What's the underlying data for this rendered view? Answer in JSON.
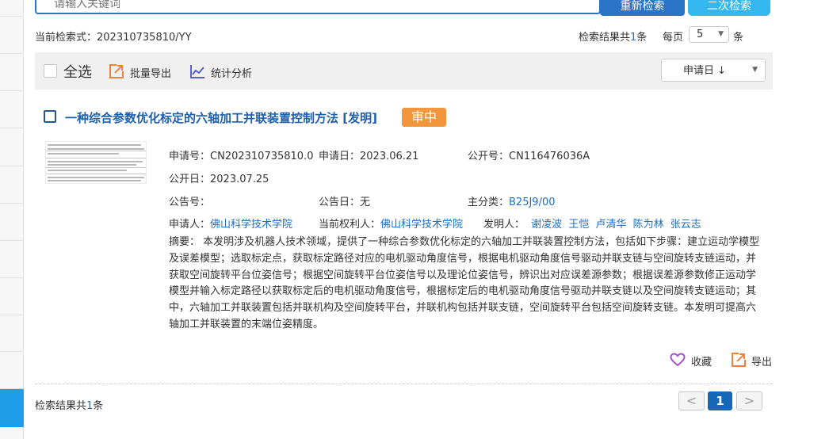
{
  "search": {
    "placeholder": "请输入关键词",
    "research_label": "重新检索",
    "advanced_label": "二次检索"
  },
  "query": {
    "prefix": "当前检索式：",
    "expression": "202310735810/YY"
  },
  "results": {
    "count_prefix": "检索结果共",
    "count": "1",
    "count_suffix": "条"
  },
  "paging": {
    "per_page_label": "每页",
    "per_page_value": "5",
    "per_page_unit": "条",
    "prev": "<",
    "current": "1",
    "next": ">"
  },
  "toolbar": {
    "select_all": "全选",
    "batch_export": "批量导出",
    "stats": "统计分析",
    "sort_value": "申请日",
    "sort_arrow": "↓"
  },
  "item": {
    "title": "一种综合参数优化标定的六轴加工并联装置控制方法 [发明]",
    "status": "审中",
    "app_no_label": "申请号：",
    "app_no": "CN202310735810.0",
    "app_date_label": "申请日：",
    "app_date": "2023.06.21",
    "pub_no_label": "公开号：",
    "pub_no": "CN116476036A",
    "pub_date_label": "公开日：",
    "pub_date": "2023.07.25",
    "announce_no_label": "公告号：",
    "announce_no": "",
    "announce_date_label": "公告日：",
    "announce_date": "无",
    "main_class_label": "主分类：",
    "main_class": "B25J9/00",
    "applicant_label": "申请人：",
    "applicant": "佛山科学技术学院",
    "holder_label": "当前权利人：",
    "holder": "佛山科学技术学院",
    "inventor_label": "发明人：",
    "inventors": [
      "谢凌波",
      "王恺",
      "卢清华",
      "陈为林",
      "张云志"
    ],
    "abstract_label": "摘要：",
    "abstract": "本发明涉及机器人技术领域，提供了一种综合参数优化标定的六轴加工并联装置控制方法，包括如下步骤：建立运动学模型及误差模型；选取标定点，获取标定路径对应的电机驱动角度信号，根据电机驱动角度信号驱动并联支链与空间旋转支链运动，并获取空间旋转平台位姿信号；根据空间旋转平台位姿信号以及理论位姿信号，辨识出对应误差源参数；根据误差源参数修正运动学模型并输入标定路径以获取标定后的电机驱动角度信号，根据标定后的电机驱动角度信号驱动并联支链以及空间旋转支链运动；其中，六轴加工并联装置包括并联机构及空间旋转平台，并联机构包括并联支链，空间旋转平台包括空间旋转支链。本发明可提高六轴加工并联装置的末端位姿精度。",
    "favorite_label": "收藏",
    "export_label": "导出"
  },
  "colors": {
    "primary": "#2a74c8",
    "secondary": "#34b6ee",
    "link": "#1e6fc4",
    "status": "#f1963a",
    "favorite": "#a84fd0",
    "export": "#f0813a"
  },
  "icons": {
    "batch_export": "export-icon",
    "stats": "chart-line-icon",
    "favorite": "heart-icon",
    "export": "export-icon"
  }
}
